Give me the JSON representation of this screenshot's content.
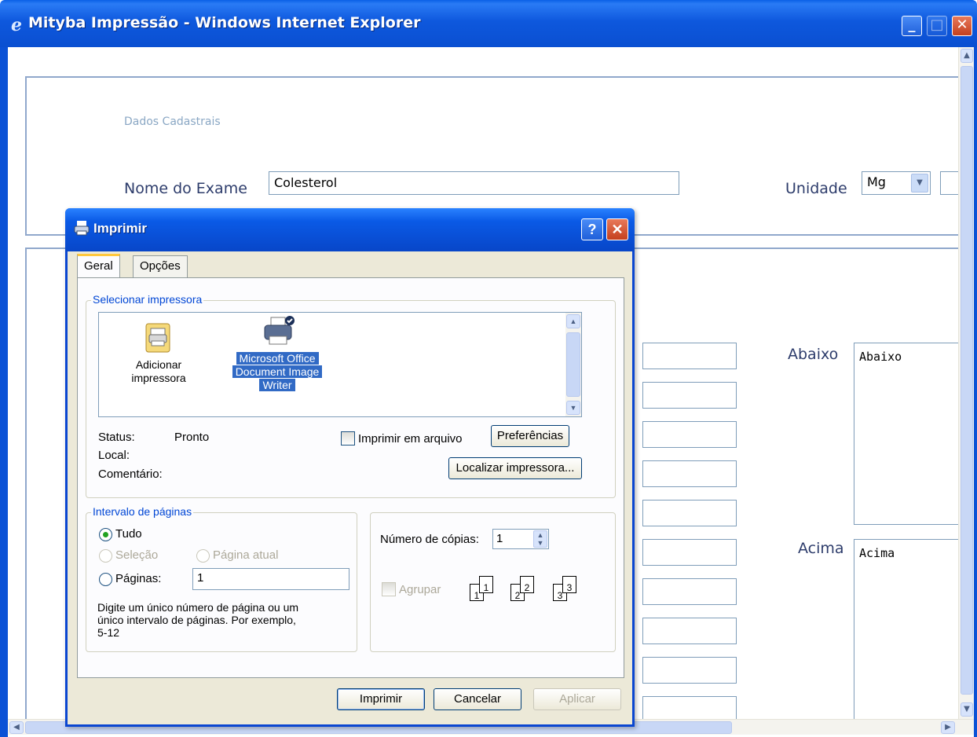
{
  "window": {
    "title": "Mityba Impressão - Windows Internet Explorer"
  },
  "page": {
    "section_caption": "Dados Cadastrais",
    "exam_name_label": "Nome do Exame",
    "exam_name_value": "Colesterol",
    "unit_label": "Unidade",
    "unit_value": "Mg",
    "below_label": "Abaixo",
    "below_value": "Abaixo",
    "above_label": "Acima",
    "above_value": "Acima"
  },
  "dialog": {
    "title": "Imprimir",
    "help_label": "?",
    "tabs": [
      "Geral",
      "Opções"
    ],
    "printer_group": "Selecionar impressora",
    "printers": [
      {
        "label_lines": [
          "Adicionar",
          "impressora"
        ]
      },
      {
        "label_lines": [
          "Microsoft Office",
          "Document Image",
          "Writer"
        ]
      }
    ],
    "status_label": "Status:",
    "status_value": "Pronto",
    "location_label": "Local:",
    "comment_label": "Comentário:",
    "print_to_file_label": "Imprimir em arquivo",
    "preferences_button": "Preferências",
    "find_printer_button": "Localizar impressora...",
    "page_range_group": "Intervalo de páginas",
    "range_all": "Tudo",
    "range_selection": "Seleção",
    "range_current": "Página atual",
    "range_pages": "Páginas:",
    "pages_value": "1",
    "pages_hint_lines": [
      "Digite um único número de página ou um",
      "único intervalo de páginas. Por exemplo,",
      "5-12"
    ],
    "copies_label": "Número de cópias:",
    "copies_value": "1",
    "collate_label": "Agrupar",
    "collate_pages": [
      "1",
      "1",
      "2",
      "2",
      "3",
      "3"
    ],
    "print_button": "Imprimir",
    "cancel_button": "Cancelar",
    "apply_button": "Aplicar"
  },
  "colors": {
    "xp_blue": "#0a5ae6",
    "dialog_face": "#ece9d8",
    "group_title": "#0046d5",
    "selection": "#316ac5"
  }
}
